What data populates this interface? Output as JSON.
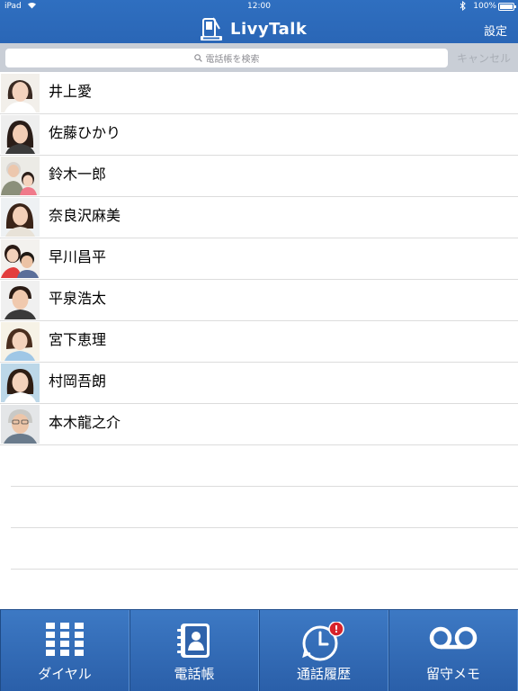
{
  "status_bar": {
    "carrier": "iPad",
    "time": "12:00",
    "battery": "100%"
  },
  "nav": {
    "title": "LivyTalk",
    "settings_label": "設定"
  },
  "search": {
    "placeholder": "電話帳を検索",
    "cancel_label": "キャンセル"
  },
  "contacts": [
    {
      "name": "井上愛"
    },
    {
      "name": "佐藤ひかり"
    },
    {
      "name": "鈴木一郎"
    },
    {
      "name": "奈良沢麻美"
    },
    {
      "name": "早川昌平"
    },
    {
      "name": "平泉浩太"
    },
    {
      "name": "宮下恵理"
    },
    {
      "name": "村岡吾朗"
    },
    {
      "name": "本木龍之介"
    }
  ],
  "tabs": [
    {
      "label": "ダイヤル",
      "icon": "dialpad-icon"
    },
    {
      "label": "電話帳",
      "icon": "phonebook-icon"
    },
    {
      "label": "通話履歴",
      "icon": "call-history-icon",
      "badge": "!"
    },
    {
      "label": "留守メモ",
      "icon": "voicemail-icon"
    }
  ],
  "colors": {
    "header": "#2f6fc0",
    "tabbar": "#3566b3",
    "badge": "#d8232a"
  }
}
